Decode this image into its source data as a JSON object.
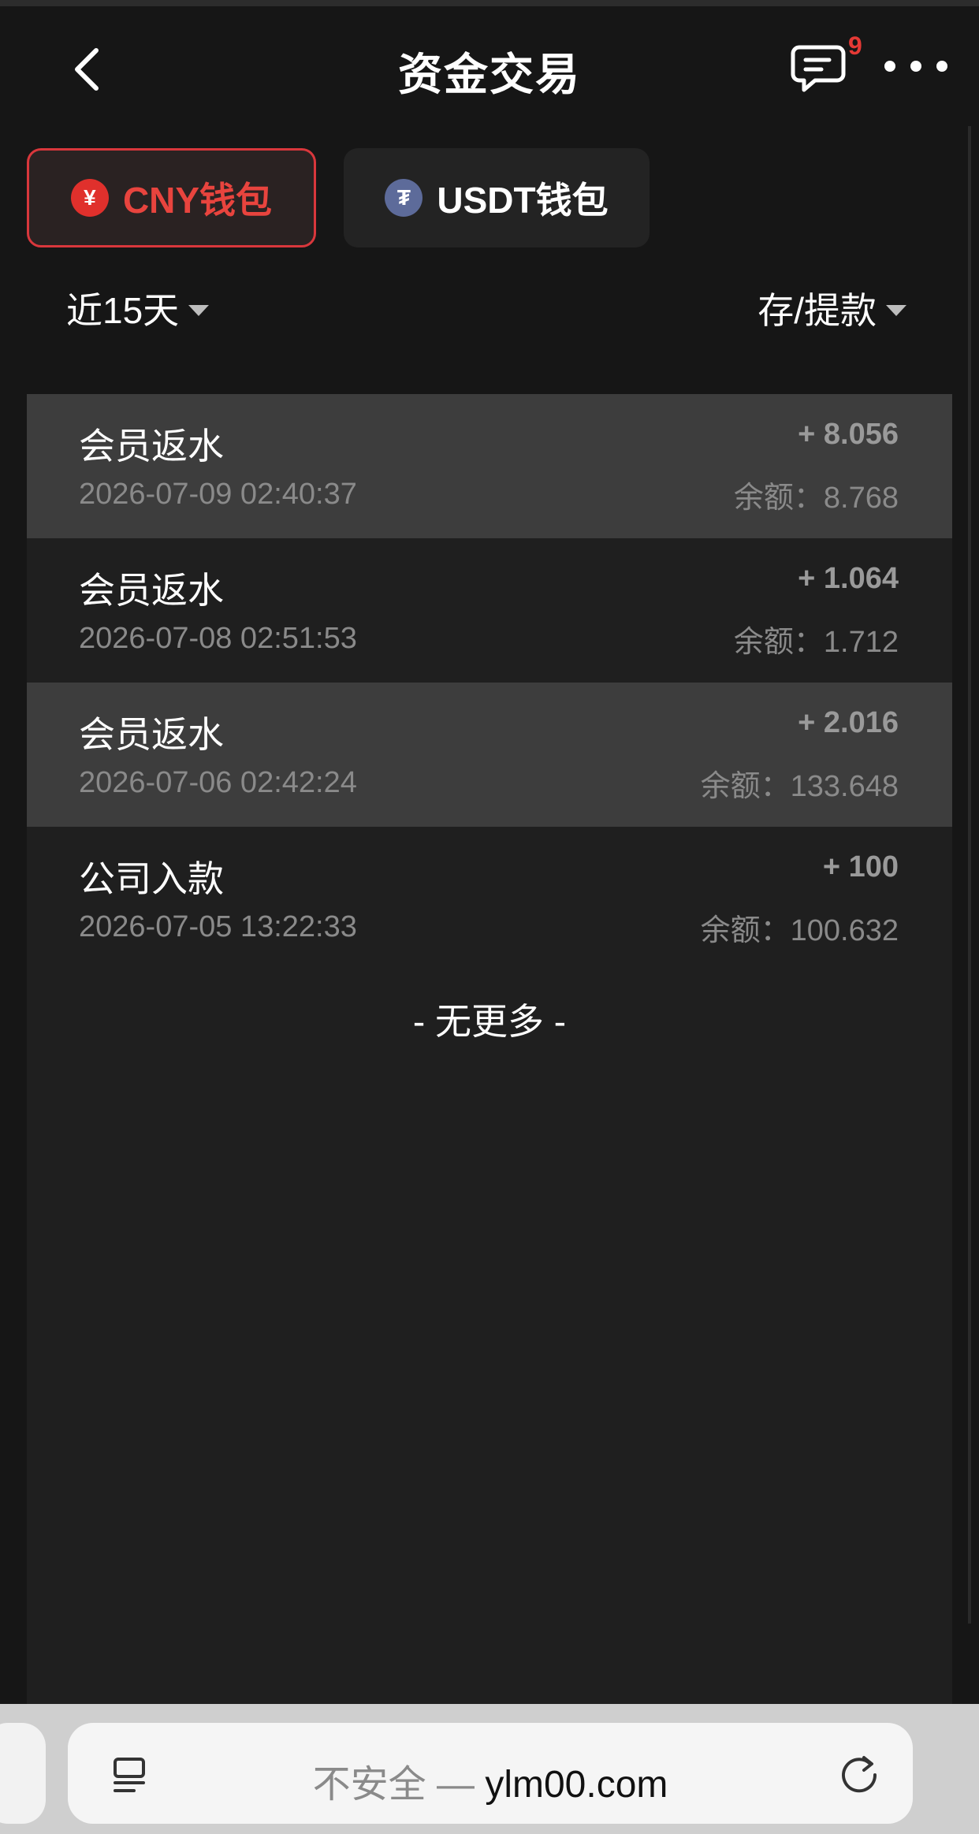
{
  "header": {
    "title": "资金交易",
    "message_badge": "9"
  },
  "wallets": [
    {
      "label": "CNY钱包",
      "icon": "yuan-coin-icon",
      "symbol": "¥",
      "active": true
    },
    {
      "label": "USDT钱包",
      "icon": "tether-coin-icon",
      "symbol": "₮",
      "active": false
    }
  ],
  "filters": {
    "period": "近15天",
    "type": "存/提款"
  },
  "transactions": [
    {
      "title": "会员返水",
      "time": "2026-07-09 02:40:37",
      "amount": "+ 8.056",
      "balance": "余额：8.768",
      "highlighted": true
    },
    {
      "title": "会员返水",
      "time": "2026-07-08 02:51:53",
      "amount": "+ 1.064",
      "balance": "余额：1.712",
      "highlighted": false
    },
    {
      "title": "会员返水",
      "time": "2026-07-06 02:42:24",
      "amount": "+ 2.016",
      "balance": "余额：133.648",
      "highlighted": true
    },
    {
      "title": "公司入款",
      "time": "2026-07-05 13:22:33",
      "amount": "+ 100",
      "balance": "余额：100.632",
      "highlighted": false
    }
  ],
  "list_footer": "- 无更多 -",
  "browser": {
    "insecure_label": "不安全 —",
    "domain": "ylm00.com"
  },
  "colors": {
    "accent": "#e8443e",
    "background": "#161616",
    "panel": "#1f1f1f",
    "row_highlight": "#3d3d3d"
  }
}
